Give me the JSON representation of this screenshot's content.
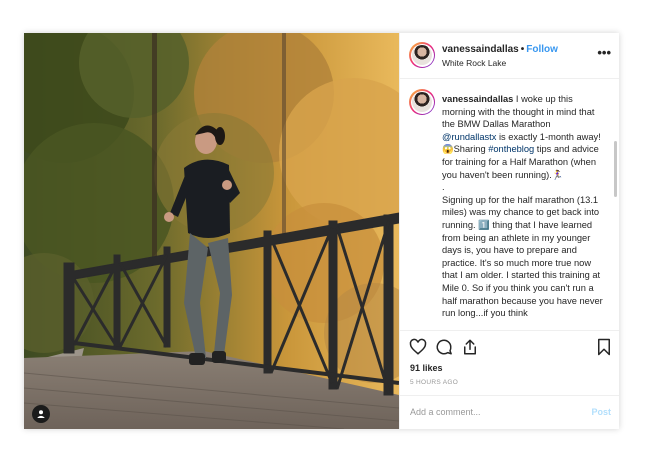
{
  "post": {
    "username": "vanessaindallas",
    "follow_label": "Follow",
    "location": "White Rock Lake",
    "more_label": "•••",
    "caption": {
      "username": "vanessaindallas",
      "text_1": "I woke up this morning with the thought in mind that the BMW Dallas Marathon ",
      "mention": "@rundallastx",
      "text_2": " is exactly 1-month away! 😱Sharing ",
      "hashtag": "#ontheblog",
      "text_3": " tips and advice for training for a Half Marathon (when you haven't been running).🏃‍♀️",
      "dot": ".",
      "paragraph_2": "Signing up for the half marathon (13.1 miles) was my chance to get back into running. 1️⃣ thing that I have learned from being an athlete in my younger days is, you have to prepare and practice. It's so much more true now that I am older. I started this training at Mile 0. So if you think you can't run a half marathon because you have never run long...if you think"
    },
    "likes": "91 likes",
    "time": "5 HOURS AGO",
    "add_comment_placeholder": "Add a comment...",
    "post_label": "Post"
  },
  "icons": {
    "like": "heart-icon",
    "comment": "comment-icon",
    "share": "share-icon",
    "save": "bookmark-icon",
    "more": "more-icon",
    "tag": "user-tag-icon"
  },
  "colors": {
    "link": "#3897f0",
    "mention": "#003569",
    "post_disabled": "#b2dffc",
    "muted": "#999999"
  }
}
